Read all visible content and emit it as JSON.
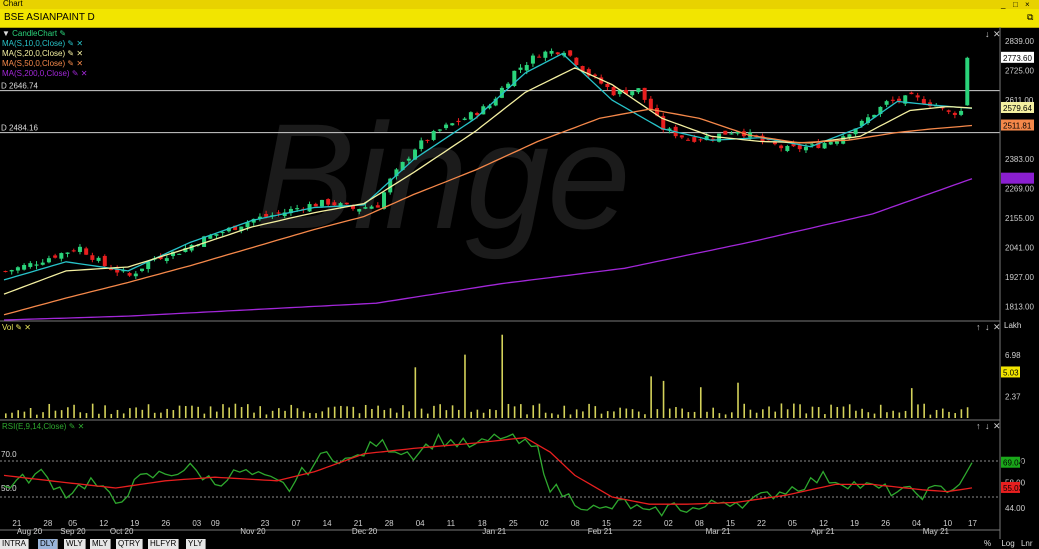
{
  "window": {
    "title": "Chart",
    "controls": [
      "_",
      "□",
      "×"
    ]
  },
  "header": {
    "symbol": "BSE ASIANPAINT D",
    "detach_icon": "restore-icon"
  },
  "legend_items": [
    {
      "label": "CandleChart",
      "color": "#2bd47b"
    },
    {
      "label": "MA(S,10,0,Close)",
      "color": "#27c3c9"
    },
    {
      "label": "MA(S,20,0,Close)",
      "color": "#f4f0a1"
    },
    {
      "label": "MA(S,50,0,Close)",
      "color": "#f5884a"
    },
    {
      "label": "MA(S,200,0,Close)",
      "color": "#a227d9"
    }
  ],
  "hlines": [
    {
      "label": "D 2646.74",
      "value": 2646.74
    },
    {
      "label": "D 2484.16",
      "value": 2484.16
    }
  ],
  "price_labels": [
    {
      "text": "2773.60",
      "value": 2773.6,
      "bg": "#ffffff",
      "fg": "#000000"
    },
    {
      "text": "2579.64",
      "value": 2579.64,
      "bg": "#f4f0a1",
      "fg": "#000000"
    },
    {
      "text": "2511.81",
      "value": 2511.81,
      "bg": "#f5884a",
      "fg": "#000000"
    },
    {
      "text": "2306.36",
      "value": 2306.36,
      "bg": "#8a1fd0",
      "fg": "#8a1fd0"
    }
  ],
  "vol_panel": {
    "label": "Vol",
    "unit": "Lakh",
    "last_label": "5.03"
  },
  "rsi_panel": {
    "label": "RSI(E,9,14,Close)",
    "label_70": "70.0",
    "label_50": "50.0",
    "rsi_box": "69.04",
    "signal_box": "55.03"
  },
  "bottom_tabs": [
    "INTRA",
    "DLY",
    "WLY",
    "MLY",
    "QTRY",
    "HLFYR",
    "YLY"
  ],
  "active_tab": "DLY",
  "bottom_right": [
    "%",
    "Log",
    "Lnr"
  ],
  "watermark": "Binge",
  "chart_data": [
    {
      "type": "candlestick",
      "title": "BSE ASIANPAINT D",
      "ylim": [
        1760,
        2885
      ],
      "yticks": [
        1813,
        1927,
        2041,
        2155,
        2269,
        2383,
        2497,
        2611,
        2725,
        2839
      ],
      "ytick_labels": [
        "1813.00",
        "1927.00",
        "2041.00",
        "2155.00",
        "2269.00",
        "2383.00",
        "",
        "2611.00",
        "2725.00",
        "2839.00"
      ],
      "x_tick_labels": [
        {
          "bar": 2,
          "text": "21"
        },
        {
          "bar": 7,
          "text": "28"
        },
        {
          "bar": 11,
          "text": "05"
        },
        {
          "bar": 16,
          "text": "12"
        },
        {
          "bar": 21,
          "text": "19"
        },
        {
          "bar": 26,
          "text": "26"
        },
        {
          "bar": 31,
          "text": "03"
        },
        {
          "bar": 34,
          "text": "09"
        },
        {
          "bar": 42,
          "text": "23"
        },
        {
          "bar": 47,
          "text": "07"
        },
        {
          "bar": 52,
          "text": "14"
        },
        {
          "bar": 57,
          "text": "21"
        },
        {
          "bar": 62,
          "text": "28"
        },
        {
          "bar": 67,
          "text": "04"
        },
        {
          "bar": 72,
          "text": "11"
        },
        {
          "bar": 77,
          "text": "18"
        },
        {
          "bar": 82,
          "text": "25"
        },
        {
          "bar": 87,
          "text": "02"
        },
        {
          "bar": 92,
          "text": "08"
        },
        {
          "bar": 97,
          "text": "15"
        },
        {
          "bar": 102,
          "text": "22"
        },
        {
          "bar": 107,
          "text": "02"
        },
        {
          "bar": 112,
          "text": "08"
        },
        {
          "bar": 117,
          "text": "15"
        },
        {
          "bar": 122,
          "text": "22"
        },
        {
          "bar": 127,
          "text": "05"
        },
        {
          "bar": 132,
          "text": "12"
        },
        {
          "bar": 137,
          "text": "19"
        },
        {
          "bar": 142,
          "text": "26"
        },
        {
          "bar": 147,
          "text": "04"
        },
        {
          "bar": 152,
          "text": "10"
        },
        {
          "bar": 156,
          "text": "17"
        }
      ],
      "x_month_labels": [
        {
          "bar": 4,
          "text": "Aug 20"
        },
        {
          "bar": 11,
          "text": "Sep 20"
        },
        {
          "bar": 19,
          "text": "Oct 20"
        },
        {
          "bar": 40,
          "text": "Nov 20"
        },
        {
          "bar": 58,
          "text": "Dec 20"
        },
        {
          "bar": 79,
          "text": "Jan 21"
        },
        {
          "bar": 96,
          "text": "Feb 21"
        },
        {
          "bar": 115,
          "text": "Mar 21"
        },
        {
          "bar": 132,
          "text": "Apr 21"
        },
        {
          "bar": 150,
          "text": "May 21"
        }
      ],
      "n_bars": 156,
      "close_points": [
        [
          0,
          1948
        ],
        [
          4,
          1975
        ],
        [
          8,
          2010
        ],
        [
          12,
          2040
        ],
        [
          16,
          1970
        ],
        [
          20,
          1930
        ],
        [
          24,
          2000
        ],
        [
          28,
          2025
        ],
        [
          32,
          2075
        ],
        [
          36,
          2110
        ],
        [
          40,
          2150
        ],
        [
          44,
          2170
        ],
        [
          48,
          2200
        ],
        [
          52,
          2215
        ],
        [
          56,
          2190
        ],
        [
          60,
          2205
        ],
        [
          62,
          2300
        ],
        [
          66,
          2425
        ],
        [
          70,
          2495
        ],
        [
          74,
          2540
        ],
        [
          78,
          2590
        ],
        [
          82,
          2720
        ],
        [
          86,
          2790
        ],
        [
          90,
          2805
        ],
        [
          94,
          2710
        ],
        [
          98,
          2640
        ],
        [
          102,
          2650
        ],
        [
          106,
          2500
        ],
        [
          110,
          2460
        ],
        [
          114,
          2470
        ],
        [
          118,
          2495
        ],
        [
          122,
          2450
        ],
        [
          126,
          2420
        ],
        [
          130,
          2430
        ],
        [
          134,
          2460
        ],
        [
          138,
          2520
        ],
        [
          142,
          2600
        ],
        [
          146,
          2620
        ],
        [
          150,
          2590
        ],
        [
          152,
          2560
        ],
        [
          155,
          2570
        ],
        [
          156,
          2773.6
        ]
      ],
      "ma_points": {
        "MA(S,10,0,Close)": [
          [
            0,
            1915
          ],
          [
            10,
            1985
          ],
          [
            20,
            1950
          ],
          [
            30,
            2060
          ],
          [
            40,
            2145
          ],
          [
            50,
            2195
          ],
          [
            58,
            2205
          ],
          [
            66,
            2380
          ],
          [
            76,
            2540
          ],
          [
            84,
            2715
          ],
          [
            90,
            2790
          ],
          [
            98,
            2610
          ],
          [
            106,
            2500
          ],
          [
            114,
            2455
          ],
          [
            122,
            2465
          ],
          [
            130,
            2430
          ],
          [
            138,
            2505
          ],
          [
            144,
            2605
          ],
          [
            150,
            2590
          ],
          [
            156,
            2578
          ]
        ],
        "MA(S,20,0,Close)": [
          [
            0,
            1860
          ],
          [
            10,
            1950
          ],
          [
            20,
            1965
          ],
          [
            30,
            2040
          ],
          [
            40,
            2120
          ],
          [
            50,
            2175
          ],
          [
            58,
            2210
          ],
          [
            66,
            2330
          ],
          [
            76,
            2490
          ],
          [
            84,
            2640
          ],
          [
            92,
            2735
          ],
          [
            98,
            2670
          ],
          [
            106,
            2540
          ],
          [
            114,
            2470
          ],
          [
            122,
            2450
          ],
          [
            130,
            2445
          ],
          [
            138,
            2470
          ],
          [
            146,
            2570
          ],
          [
            152,
            2585
          ],
          [
            156,
            2579.64
          ]
        ],
        "MA(S,50,0,Close)": [
          [
            0,
            1780
          ],
          [
            10,
            1845
          ],
          [
            20,
            1905
          ],
          [
            30,
            1970
          ],
          [
            40,
            2040
          ],
          [
            50,
            2110
          ],
          [
            58,
            2160
          ],
          [
            66,
            2245
          ],
          [
            76,
            2340
          ],
          [
            86,
            2450
          ],
          [
            96,
            2540
          ],
          [
            104,
            2575
          ],
          [
            112,
            2540
          ],
          [
            120,
            2475
          ],
          [
            128,
            2445
          ],
          [
            136,
            2455
          ],
          [
            144,
            2485
          ],
          [
            150,
            2500
          ],
          [
            156,
            2511.81
          ]
        ],
        "MA(S,200,0,Close)": [
          [
            0,
            1760
          ],
          [
            20,
            1775
          ],
          [
            40,
            1800
          ],
          [
            60,
            1825
          ],
          [
            80,
            1900
          ],
          [
            100,
            1960
          ],
          [
            120,
            2060
          ],
          [
            140,
            2170
          ],
          [
            156,
            2306.36
          ]
        ]
      }
    },
    {
      "type": "bar",
      "title": "Vol",
      "unit": "Lakh",
      "yticks": [
        2.37,
        6.98
      ],
      "ytick_labels": [
        "2.37",
        "6.98"
      ],
      "ylim": [
        0,
        9.5
      ],
      "last_value": 5.03,
      "spikes": [
        [
          66,
          5.6
        ],
        [
          74,
          7.0
        ],
        [
          80,
          9.2
        ],
        [
          104,
          4.6
        ],
        [
          106,
          4.1
        ],
        [
          112,
          3.4
        ],
        [
          118,
          3.9
        ],
        [
          146,
          3.3
        ],
        [
          156,
          5.03
        ]
      ],
      "baseline": 0.9
    },
    {
      "type": "line",
      "title": "RSI(E,9,14,Close)",
      "ylim": [
        35,
        90
      ],
      "yticks": [
        44,
        58,
        70
      ],
      "ytick_labels": [
        "44.00",
        "58.00",
        "70.00"
      ],
      "reference_lines": [
        70,
        50
      ],
      "series": [
        {
          "name": "RSI",
          "color": "#2ea82e",
          "values": [
            [
              0,
              56
            ],
            [
              6,
              63
            ],
            [
              10,
              52
            ],
            [
              14,
              59
            ],
            [
              18,
              47
            ],
            [
              22,
              60
            ],
            [
              26,
              63
            ],
            [
              30,
              66
            ],
            [
              34,
              58
            ],
            [
              38,
              64
            ],
            [
              42,
              60
            ],
            [
              46,
              55
            ],
            [
              48,
              63
            ],
            [
              52,
              74
            ],
            [
              56,
              70
            ],
            [
              60,
              80
            ],
            [
              66,
              74
            ],
            [
              70,
              82
            ],
            [
              76,
              78
            ],
            [
              80,
              84
            ],
            [
              84,
              79
            ],
            [
              86,
              76
            ],
            [
              88,
              56
            ],
            [
              92,
              48
            ],
            [
              96,
              42
            ],
            [
              100,
              47
            ],
            [
              104,
              40
            ],
            [
              108,
              45
            ],
            [
              112,
              43
            ],
            [
              116,
              48
            ],
            [
              120,
              47
            ],
            [
              124,
              52
            ],
            [
              128,
              56
            ],
            [
              132,
              61
            ],
            [
              136,
              58
            ],
            [
              140,
              55
            ],
            [
              144,
              53
            ],
            [
              148,
              52
            ],
            [
              152,
              55
            ],
            [
              154,
              57
            ],
            [
              156,
              69.04
            ]
          ]
        },
        {
          "name": "Signal",
          "color": "#e81f1f",
          "values": [
            [
              0,
              62
            ],
            [
              10,
              58
            ],
            [
              18,
              55
            ],
            [
              26,
              59
            ],
            [
              34,
              61
            ],
            [
              44,
              59
            ],
            [
              50,
              64
            ],
            [
              58,
              74
            ],
            [
              66,
              77
            ],
            [
              76,
              80
            ],
            [
              84,
              83
            ],
            [
              88,
              75
            ],
            [
              92,
              62
            ],
            [
              98,
              50
            ],
            [
              104,
              46
            ],
            [
              110,
              46
            ],
            [
              118,
              47
            ],
            [
              126,
              51
            ],
            [
              134,
              57
            ],
            [
              140,
              57
            ],
            [
              148,
              54
            ],
            [
              152,
              53
            ],
            [
              156,
              55.03
            ]
          ]
        }
      ]
    }
  ]
}
